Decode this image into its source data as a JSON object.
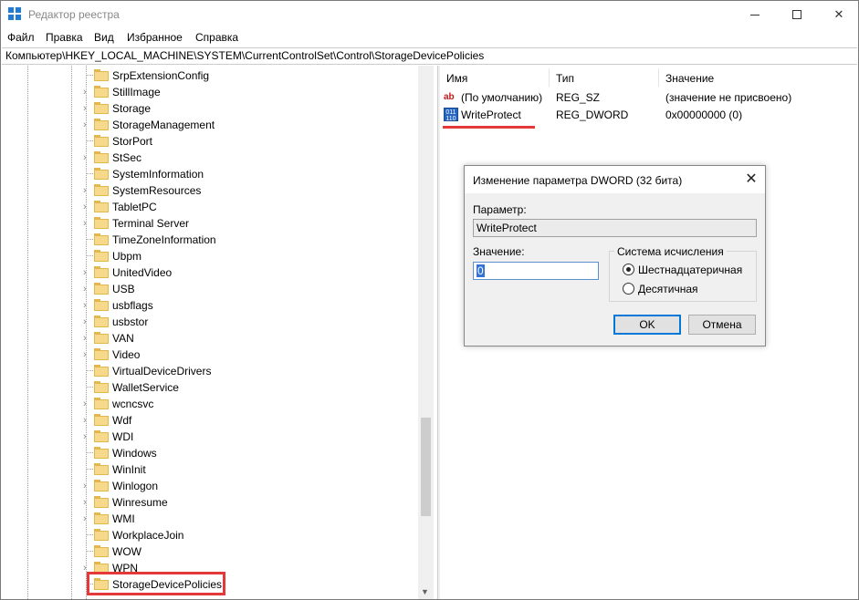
{
  "window": {
    "title": "Редактор реестра",
    "minimize_icon": "minimize-icon",
    "maximize_icon": "maximize-icon",
    "close_glyph": "✕"
  },
  "menu": [
    "Файл",
    "Правка",
    "Вид",
    "Избранное",
    "Справка"
  ],
  "address": "Компьютер\\HKEY_LOCAL_MACHINE\\SYSTEM\\CurrentControlSet\\Control\\StorageDevicePolicies",
  "tree": {
    "items": [
      {
        "label": "SrpExtensionConfig",
        "expandable": false
      },
      {
        "label": "StillImage",
        "expandable": true
      },
      {
        "label": "Storage",
        "expandable": true
      },
      {
        "label": "StorageManagement",
        "expandable": true
      },
      {
        "label": "StorPort",
        "expandable": false
      },
      {
        "label": "StSec",
        "expandable": true
      },
      {
        "label": "SystemInformation",
        "expandable": false
      },
      {
        "label": "SystemResources",
        "expandable": true
      },
      {
        "label": "TabletPC",
        "expandable": true
      },
      {
        "label": "Terminal Server",
        "expandable": true
      },
      {
        "label": "TimeZoneInformation",
        "expandable": false
      },
      {
        "label": "Ubpm",
        "expandable": false
      },
      {
        "label": "UnitedVideo",
        "expandable": true
      },
      {
        "label": "USB",
        "expandable": true
      },
      {
        "label": "usbflags",
        "expandable": true
      },
      {
        "label": "usbstor",
        "expandable": true
      },
      {
        "label": "VAN",
        "expandable": true
      },
      {
        "label": "Video",
        "expandable": true
      },
      {
        "label": "VirtualDeviceDrivers",
        "expandable": false
      },
      {
        "label": "WalletService",
        "expandable": false
      },
      {
        "label": "wcncsvc",
        "expandable": true
      },
      {
        "label": "Wdf",
        "expandable": true
      },
      {
        "label": "WDI",
        "expandable": true
      },
      {
        "label": "Windows",
        "expandable": false
      },
      {
        "label": "WinInit",
        "expandable": false
      },
      {
        "label": "Winlogon",
        "expandable": true
      },
      {
        "label": "Winresume",
        "expandable": true
      },
      {
        "label": "WMI",
        "expandable": true
      },
      {
        "label": "WorkplaceJoin",
        "expandable": false
      },
      {
        "label": "WOW",
        "expandable": false
      },
      {
        "label": "WPN",
        "expandable": true
      },
      {
        "label": "StorageDevicePolicies",
        "expandable": false,
        "highlighted": true
      }
    ],
    "highlight_color": "#e53939"
  },
  "list": {
    "headers": {
      "name": "Имя",
      "type": "Тип",
      "value": "Значение"
    },
    "rows": [
      {
        "icon": "string-value-icon",
        "icon_text": "ab",
        "name": "(По умолчанию)",
        "type": "REG_SZ",
        "value": "(значение не присвоено)"
      },
      {
        "icon": "binary-value-icon",
        "icon_text": "011\n110",
        "name": "WriteProtect",
        "type": "REG_DWORD",
        "value": "0x00000000 (0)"
      }
    ]
  },
  "dialog": {
    "title": "Изменение параметра DWORD (32 бита)",
    "param_label": "Параметр:",
    "param_value": "WriteProtect",
    "value_label": "Значение:",
    "value_text": "0",
    "base_group": "Система исчисления",
    "radio_hex": "Шестнадцатеричная",
    "radio_dec": "Десятичная",
    "selected_base": "hex",
    "ok": "OK",
    "cancel": "Отмена"
  }
}
